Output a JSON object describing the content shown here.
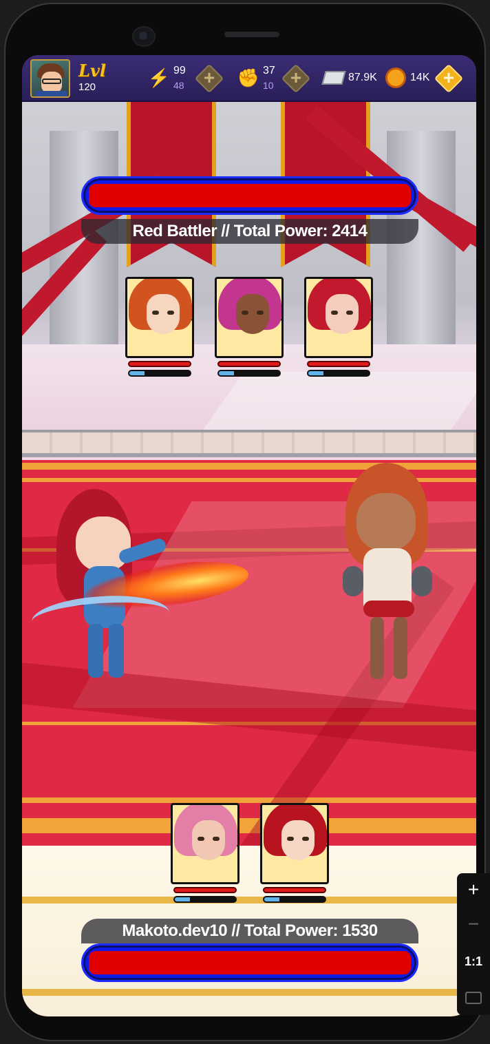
{
  "player": {
    "level_label": "Lvl",
    "level": "120",
    "energy": "99",
    "energy_sub": "48",
    "fight": "37",
    "fight_sub": "10",
    "money": "87.9K",
    "coins": "14K"
  },
  "enemy_team": {
    "label": "Red Battler // Total Power:  2414",
    "health_fraction": 1.0,
    "members": [
      {
        "name": "orange-ponytail",
        "mana_fraction": 0.25
      },
      {
        "name": "pink-cat-ears",
        "mana_fraction": 0.25
      },
      {
        "name": "red-tiara",
        "mana_fraction": 0.25
      }
    ]
  },
  "player_team": {
    "label": "Makoto.dev10 // Total Power:  1530",
    "health_fraction": 1.0,
    "members": [
      {
        "name": "pink-hair",
        "mana_fraction": 0.25
      },
      {
        "name": "red-hair",
        "mana_fraction": 0.25
      }
    ]
  },
  "zoom_panel": {
    "zoom_in": "+",
    "zoom_out": "−",
    "ratio": "1:1"
  },
  "colors": {
    "health": "#e10000",
    "health_border": "#0d1be8",
    "mana": "#5fb4ea",
    "topbar": "#2a1f58",
    "arena": "#e02a45"
  }
}
